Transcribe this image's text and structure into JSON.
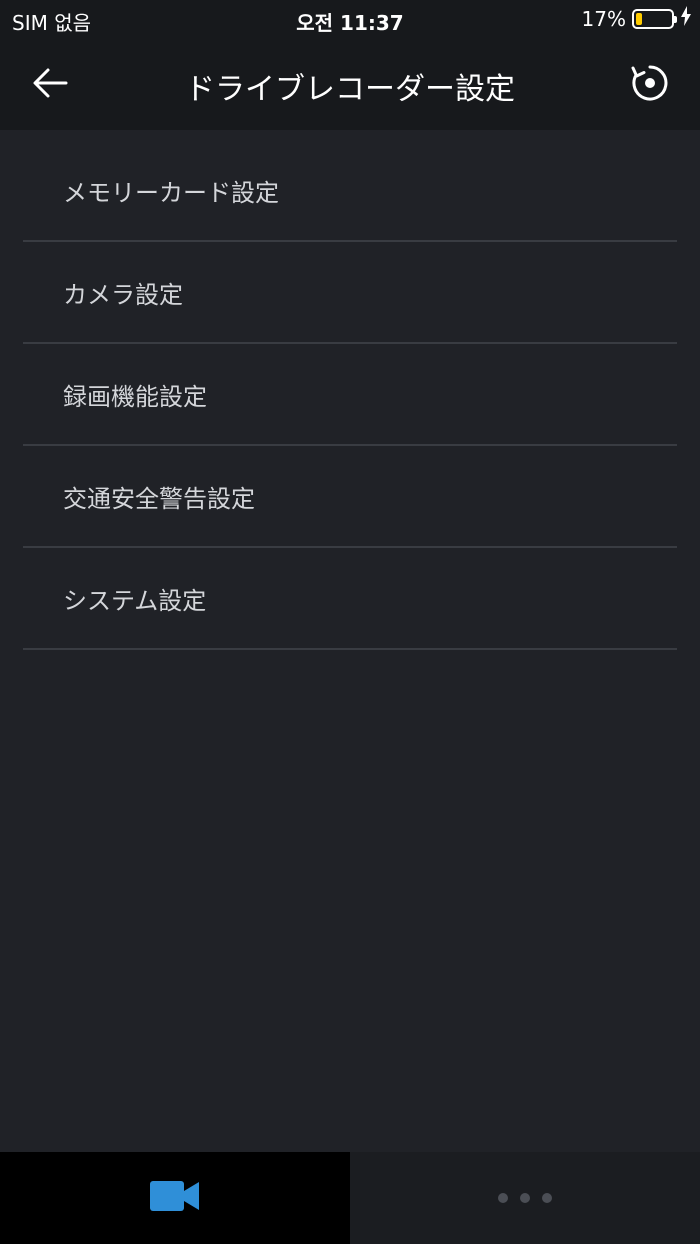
{
  "status_bar": {
    "carrier": "SIM 없음",
    "time": "오전 11:37",
    "battery_percent": "17%",
    "battery_level": 0.17,
    "charging_icon": "bolt-icon"
  },
  "header": {
    "back_icon": "arrow-left-icon",
    "title": "ドライブレコーダー設定",
    "reset_icon": "reset-icon"
  },
  "settings": {
    "items": [
      {
        "label": "メモリーカード設定"
      },
      {
        "label": "カメラ設定"
      },
      {
        "label": "録画機能設定"
      },
      {
        "label": "交通安全警告設定"
      },
      {
        "label": "システム設定"
      }
    ]
  },
  "tab_bar": {
    "tabs": [
      {
        "icon": "video-camera-icon",
        "active": true
      },
      {
        "icon": "more-dots-icon",
        "active": false
      }
    ]
  },
  "colors": {
    "accent": "#2f8fd8",
    "header_bg": "#17191c",
    "content_bg": "#202227",
    "divider": "#393c42",
    "battery_fill": "#ffcc00"
  }
}
